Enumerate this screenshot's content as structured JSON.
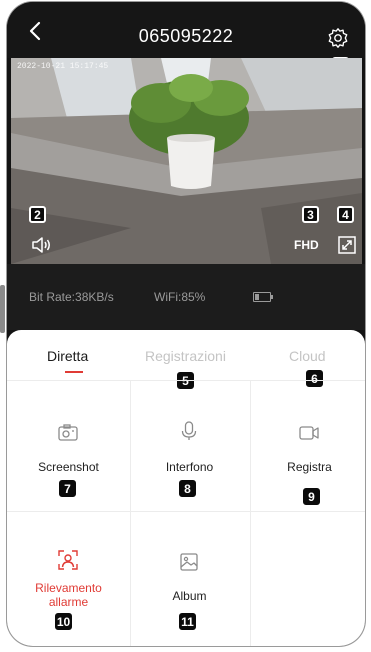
{
  "header": {
    "title": "065095222",
    "back_icon": "chevron-left-icon",
    "settings_icon": "gear-icon"
  },
  "video": {
    "timestamp": "2022-10-21 15:17:45",
    "quality_label": "FHD",
    "speaker_icon": "speaker-icon",
    "fullscreen_icon": "fullscreen-icon"
  },
  "stats": {
    "bitrate": "Bit Rate:38KB/s",
    "wifi": "WiFi:85%",
    "battery_icon": "battery-icon"
  },
  "tabs": [
    {
      "label": "Diretta",
      "active": true
    },
    {
      "label": "Registrazioni",
      "active": false
    },
    {
      "label": "Cloud",
      "active": false
    }
  ],
  "functions": [
    {
      "label": "Screenshot",
      "icon": "camera-icon"
    },
    {
      "label": "Interfono",
      "icon": "microphone-icon"
    },
    {
      "label": "Registra",
      "icon": "video-record-icon"
    },
    {
      "label_line1": "Rilevamento",
      "label_line2": "allarme",
      "icon": "alarm-detection-icon"
    },
    {
      "label": "Album",
      "icon": "image-icon"
    }
  ],
  "callouts": [
    "1",
    "2",
    "3",
    "4",
    "5",
    "6",
    "7",
    "8",
    "9",
    "10",
    "11"
  ],
  "colors": {
    "accent": "#e03b35",
    "background": "#131313",
    "panel": "#ffffff"
  }
}
